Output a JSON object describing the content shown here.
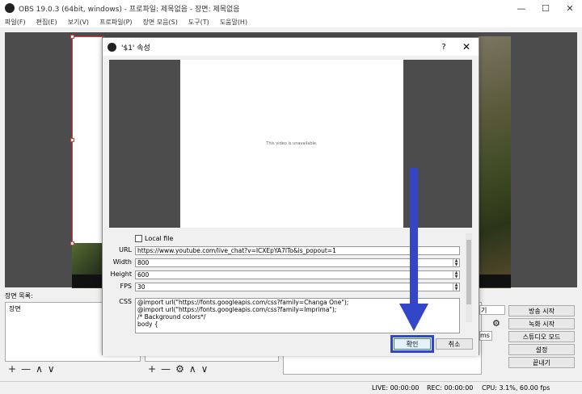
{
  "window": {
    "title": "OBS 19.0.3 (64bit, windows) - 프로파일: 제목없음 - 장면: 제목없음",
    "minimize": "—",
    "maximize": "☐",
    "close": "✕"
  },
  "menu": [
    "파일(F)",
    "편집(E)",
    "보기(V)",
    "프로파일(P)",
    "장면 모음(S)",
    "도구(T)",
    "도움말(H)"
  ],
  "docks": {
    "scenes_label": "장면 목록:",
    "scene_item": "장면",
    "scene_toolbar": [
      "+",
      "—",
      "∧",
      "∨"
    ],
    "source_toolbar": [
      "+",
      "—",
      "⚙",
      "∧",
      "∨"
    ]
  },
  "controls": {
    "start_streaming": "방송 시작",
    "start_recording": "녹화 시작",
    "studio_mode": "스튜디오 모드",
    "settings": "설정",
    "exit": "끝내기",
    "partial_dropdown_1": "기",
    "partial_dropdown_2": "ms"
  },
  "status": {
    "live": "LIVE: 00:00:00",
    "rec": "REC: 00:00:00",
    "cpu": "CPU: 3.1%, 60.00 fps"
  },
  "dialog": {
    "title": "'$1' 속성",
    "help": "?",
    "close": "✕",
    "video_message": "This video is unavailable.",
    "local_file_label": "Local file",
    "url_label": "URL",
    "url_value": "https://www.youtube.com/live_chat?v=ICXEpYA7lTo&is_popout=1",
    "width_label": "Width",
    "width_value": "800",
    "height_label": "Height",
    "height_value": "600",
    "fps_label": "FPS",
    "fps_value": "30",
    "css_label": "CSS",
    "css_lines": [
      "@import url(\"https://fonts.googleapis.com/css?family=Changa One\");",
      "@import url(\"https://fonts.googleapis.com/css?family=Imprima\");",
      "",
      "/* Background colors*/",
      "body {"
    ],
    "ok": "확인",
    "cancel": "취소"
  },
  "colors": {
    "annotation": "#3446c8",
    "selection": "#ee3333"
  },
  "icons": {
    "app": "obs-logo-icon",
    "annotation": "arrow-down-icon"
  }
}
